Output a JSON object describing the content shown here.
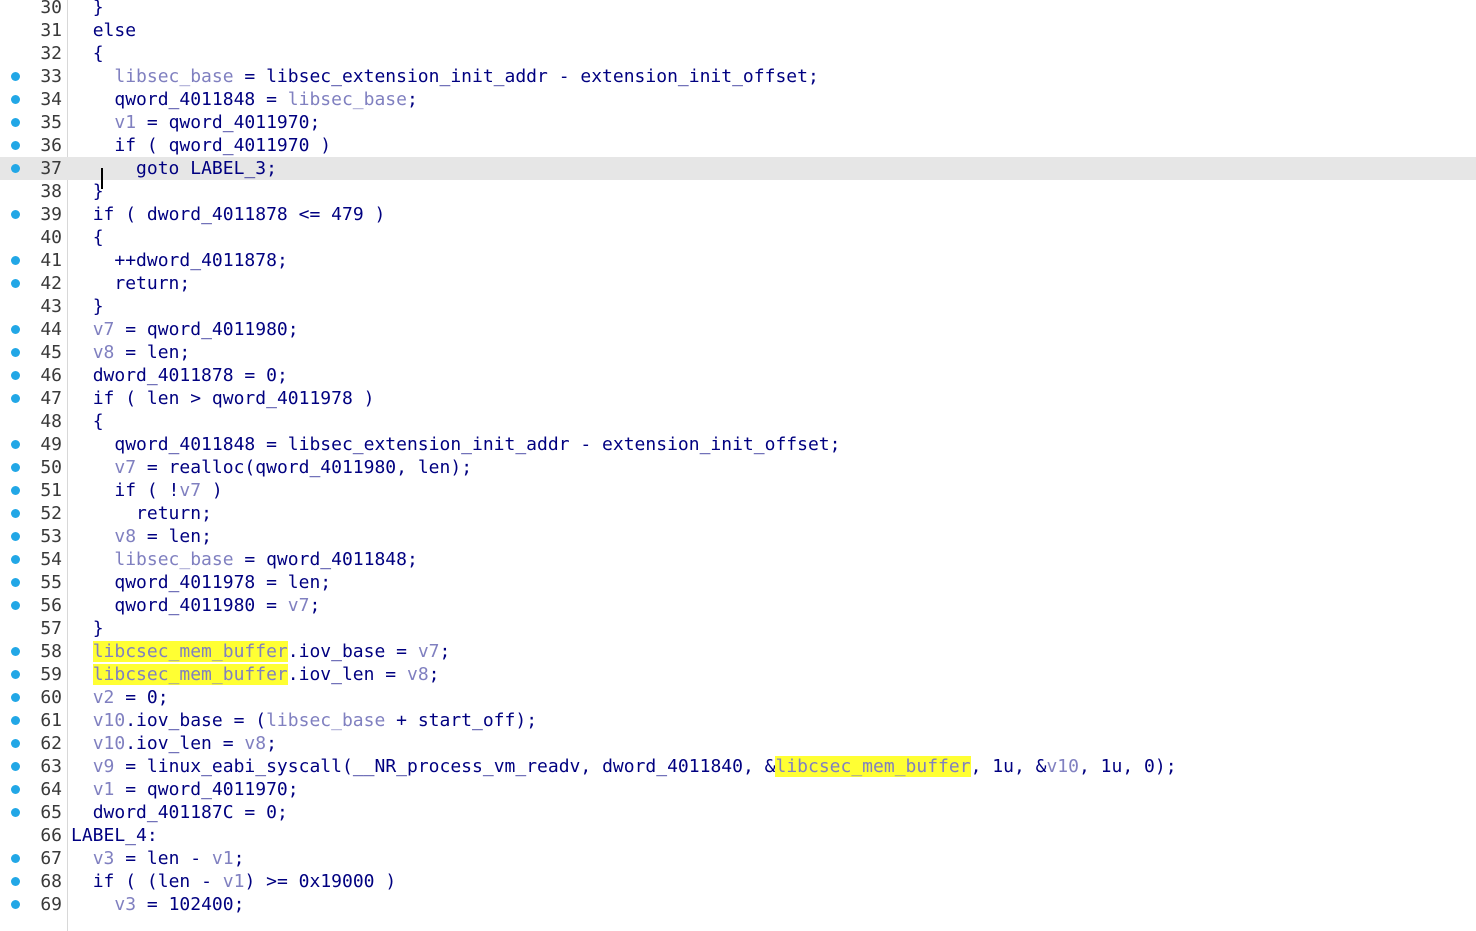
{
  "editor": {
    "first_line": 30,
    "current_line": 37,
    "highlighted_identifier": "libcsec_mem_buffer",
    "colors": {
      "code": "#000080",
      "local_var": "#8080c0",
      "highlight": "#ffff33",
      "breakpoint": "#22a7e6",
      "current_line_bg": "#e6e6e6"
    }
  },
  "lines": [
    {
      "num": "30",
      "bp": false,
      "indent": 1,
      "tokens": [
        [
          "p",
          "}"
        ]
      ]
    },
    {
      "num": "31",
      "bp": false,
      "indent": 1,
      "tokens": [
        [
          "k",
          "else"
        ]
      ]
    },
    {
      "num": "32",
      "bp": false,
      "indent": 1,
      "tokens": [
        [
          "p",
          "{"
        ]
      ]
    },
    {
      "num": "33",
      "bp": true,
      "indent": 2,
      "tokens": [
        [
          "v",
          "libsec_base"
        ],
        [
          "p",
          " = "
        ],
        [
          "i",
          "libsec_extension_init_addr"
        ],
        [
          "p",
          " - "
        ],
        [
          "i",
          "extension_init_offset"
        ],
        [
          "p",
          ";"
        ]
      ]
    },
    {
      "num": "34",
      "bp": true,
      "indent": 2,
      "tokens": [
        [
          "i",
          "qword_4011848"
        ],
        [
          "p",
          " = "
        ],
        [
          "v",
          "libsec_base"
        ],
        [
          "p",
          ";"
        ]
      ]
    },
    {
      "num": "35",
      "bp": true,
      "indent": 2,
      "tokens": [
        [
          "v",
          "v1"
        ],
        [
          "p",
          " = "
        ],
        [
          "i",
          "qword_4011970"
        ],
        [
          "p",
          ";"
        ]
      ]
    },
    {
      "num": "36",
      "bp": true,
      "indent": 2,
      "tokens": [
        [
          "k",
          "if"
        ],
        [
          "p",
          " ( "
        ],
        [
          "i",
          "qword_4011970"
        ],
        [
          "p",
          " )"
        ]
      ]
    },
    {
      "num": "37",
      "bp": true,
      "indent": 3,
      "current": true,
      "tokens": [
        [
          "k",
          "goto"
        ],
        [
          "p",
          " "
        ],
        [
          "l",
          "LABEL_3"
        ],
        [
          "p",
          ";"
        ]
      ]
    },
    {
      "num": "38",
      "bp": false,
      "indent": 1,
      "tokens": [
        [
          "p",
          "}"
        ]
      ]
    },
    {
      "num": "39",
      "bp": true,
      "indent": 1,
      "tokens": [
        [
          "k",
          "if"
        ],
        [
          "p",
          " ( "
        ],
        [
          "i",
          "dword_4011878"
        ],
        [
          "p",
          " <= "
        ],
        [
          "n",
          "479"
        ],
        [
          "p",
          " )"
        ]
      ]
    },
    {
      "num": "40",
      "bp": false,
      "indent": 1,
      "tokens": [
        [
          "p",
          "{"
        ]
      ]
    },
    {
      "num": "41",
      "bp": true,
      "indent": 2,
      "tokens": [
        [
          "p",
          "++"
        ],
        [
          "i",
          "dword_4011878"
        ],
        [
          "p",
          ";"
        ]
      ]
    },
    {
      "num": "42",
      "bp": true,
      "indent": 2,
      "tokens": [
        [
          "k",
          "return"
        ],
        [
          "p",
          ";"
        ]
      ]
    },
    {
      "num": "43",
      "bp": false,
      "indent": 1,
      "tokens": [
        [
          "p",
          "}"
        ]
      ]
    },
    {
      "num": "44",
      "bp": true,
      "indent": 1,
      "tokens": [
        [
          "v",
          "v7"
        ],
        [
          "p",
          " = "
        ],
        [
          "i",
          "qword_4011980"
        ],
        [
          "p",
          ";"
        ]
      ]
    },
    {
      "num": "45",
      "bp": true,
      "indent": 1,
      "tokens": [
        [
          "v",
          "v8"
        ],
        [
          "p",
          " = "
        ],
        [
          "i",
          "len"
        ],
        [
          "p",
          ";"
        ]
      ]
    },
    {
      "num": "46",
      "bp": true,
      "indent": 1,
      "tokens": [
        [
          "i",
          "dword_4011878"
        ],
        [
          "p",
          " = "
        ],
        [
          "n",
          "0"
        ],
        [
          "p",
          ";"
        ]
      ]
    },
    {
      "num": "47",
      "bp": true,
      "indent": 1,
      "tokens": [
        [
          "k",
          "if"
        ],
        [
          "p",
          " ( "
        ],
        [
          "i",
          "len"
        ],
        [
          "p",
          " > "
        ],
        [
          "i",
          "qword_4011978"
        ],
        [
          "p",
          " )"
        ]
      ]
    },
    {
      "num": "48",
      "bp": false,
      "indent": 1,
      "tokens": [
        [
          "p",
          "{"
        ]
      ]
    },
    {
      "num": "49",
      "bp": true,
      "indent": 2,
      "tokens": [
        [
          "i",
          "qword_4011848"
        ],
        [
          "p",
          " = "
        ],
        [
          "i",
          "libsec_extension_init_addr"
        ],
        [
          "p",
          " - "
        ],
        [
          "i",
          "extension_init_offset"
        ],
        [
          "p",
          ";"
        ]
      ]
    },
    {
      "num": "50",
      "bp": true,
      "indent": 2,
      "tokens": [
        [
          "v",
          "v7"
        ],
        [
          "p",
          " = "
        ],
        [
          "i",
          "realloc"
        ],
        [
          "p",
          "("
        ],
        [
          "i",
          "qword_4011980"
        ],
        [
          "p",
          ", "
        ],
        [
          "i",
          "len"
        ],
        [
          "p",
          ");"
        ]
      ]
    },
    {
      "num": "51",
      "bp": true,
      "indent": 2,
      "tokens": [
        [
          "k",
          "if"
        ],
        [
          "p",
          " ( !"
        ],
        [
          "v",
          "v7"
        ],
        [
          "p",
          " )"
        ]
      ]
    },
    {
      "num": "52",
      "bp": true,
      "indent": 3,
      "tokens": [
        [
          "k",
          "return"
        ],
        [
          "p",
          ";"
        ]
      ]
    },
    {
      "num": "53",
      "bp": true,
      "indent": 2,
      "tokens": [
        [
          "v",
          "v8"
        ],
        [
          "p",
          " = "
        ],
        [
          "i",
          "len"
        ],
        [
          "p",
          ";"
        ]
      ]
    },
    {
      "num": "54",
      "bp": true,
      "indent": 2,
      "tokens": [
        [
          "v",
          "libsec_base"
        ],
        [
          "p",
          " = "
        ],
        [
          "i",
          "qword_4011848"
        ],
        [
          "p",
          ";"
        ]
      ]
    },
    {
      "num": "55",
      "bp": true,
      "indent": 2,
      "tokens": [
        [
          "i",
          "qword_4011978"
        ],
        [
          "p",
          " = "
        ],
        [
          "i",
          "len"
        ],
        [
          "p",
          ";"
        ]
      ]
    },
    {
      "num": "56",
      "bp": true,
      "indent": 2,
      "tokens": [
        [
          "i",
          "qword_4011980"
        ],
        [
          "p",
          " = "
        ],
        [
          "v",
          "v7"
        ],
        [
          "p",
          ";"
        ]
      ]
    },
    {
      "num": "57",
      "bp": false,
      "indent": 1,
      "tokens": [
        [
          "p",
          "}"
        ]
      ]
    },
    {
      "num": "58",
      "bp": true,
      "indent": 1,
      "tokens": [
        [
          "h",
          "libcsec_mem_buffer"
        ],
        [
          "p",
          ".iov_base = "
        ],
        [
          "v",
          "v7"
        ],
        [
          "p",
          ";"
        ]
      ]
    },
    {
      "num": "59",
      "bp": true,
      "indent": 1,
      "tokens": [
        [
          "h",
          "libcsec_mem_buffer"
        ],
        [
          "p",
          ".iov_len = "
        ],
        [
          "v",
          "v8"
        ],
        [
          "p",
          ";"
        ]
      ]
    },
    {
      "num": "60",
      "bp": true,
      "indent": 1,
      "tokens": [
        [
          "v",
          "v2"
        ],
        [
          "p",
          " = "
        ],
        [
          "n",
          "0"
        ],
        [
          "p",
          ";"
        ]
      ]
    },
    {
      "num": "61",
      "bp": true,
      "indent": 1,
      "tokens": [
        [
          "v",
          "v10"
        ],
        [
          "p",
          ".iov_base = ("
        ],
        [
          "v",
          "libsec_base"
        ],
        [
          "p",
          " + "
        ],
        [
          "i",
          "start_off"
        ],
        [
          "p",
          ");"
        ]
      ]
    },
    {
      "num": "62",
      "bp": true,
      "indent": 1,
      "tokens": [
        [
          "v",
          "v10"
        ],
        [
          "p",
          ".iov_len = "
        ],
        [
          "v",
          "v8"
        ],
        [
          "p",
          ";"
        ]
      ]
    },
    {
      "num": "63",
      "bp": true,
      "indent": 1,
      "tokens": [
        [
          "v",
          "v9"
        ],
        [
          "p",
          " = "
        ],
        [
          "i",
          "linux_eabi_syscall"
        ],
        [
          "p",
          "("
        ],
        [
          "i",
          "__NR_process_vm_readv"
        ],
        [
          "p",
          ", "
        ],
        [
          "i",
          "dword_4011840"
        ],
        [
          "p",
          ", &"
        ],
        [
          "h",
          "libcsec_mem_buffer"
        ],
        [
          "p",
          ", "
        ],
        [
          "n",
          "1u"
        ],
        [
          "p",
          ", &"
        ],
        [
          "v",
          "v10"
        ],
        [
          "p",
          ", "
        ],
        [
          "n",
          "1u"
        ],
        [
          "p",
          ", "
        ],
        [
          "n",
          "0"
        ],
        [
          "p",
          ");"
        ]
      ]
    },
    {
      "num": "64",
      "bp": true,
      "indent": 1,
      "tokens": [
        [
          "v",
          "v1"
        ],
        [
          "p",
          " = "
        ],
        [
          "i",
          "qword_4011970"
        ],
        [
          "p",
          ";"
        ]
      ]
    },
    {
      "num": "65",
      "bp": true,
      "indent": 1,
      "tokens": [
        [
          "i",
          "dword_401187C"
        ],
        [
          "p",
          " = "
        ],
        [
          "n",
          "0"
        ],
        [
          "p",
          ";"
        ]
      ]
    },
    {
      "num": "66",
      "bp": false,
      "indent": 0,
      "tokens": [
        [
          "l",
          "LABEL_4"
        ],
        [
          "p",
          ":"
        ]
      ]
    },
    {
      "num": "67",
      "bp": true,
      "indent": 1,
      "tokens": [
        [
          "v",
          "v3"
        ],
        [
          "p",
          " = "
        ],
        [
          "i",
          "len"
        ],
        [
          "p",
          " - "
        ],
        [
          "v",
          "v1"
        ],
        [
          "p",
          ";"
        ]
      ]
    },
    {
      "num": "68",
      "bp": true,
      "indent": 1,
      "tokens": [
        [
          "k",
          "if"
        ],
        [
          "p",
          " ( ("
        ],
        [
          "i",
          "len"
        ],
        [
          "p",
          " - "
        ],
        [
          "v",
          "v1"
        ],
        [
          "p",
          ") >= "
        ],
        [
          "n",
          "0x19000"
        ],
        [
          "p",
          " )"
        ]
      ]
    },
    {
      "num": "69",
      "bp": true,
      "indent": 2,
      "tokens": [
        [
          "v",
          "v3"
        ],
        [
          "p",
          " = "
        ],
        [
          "n",
          "102400"
        ],
        [
          "p",
          ";"
        ]
      ]
    }
  ]
}
